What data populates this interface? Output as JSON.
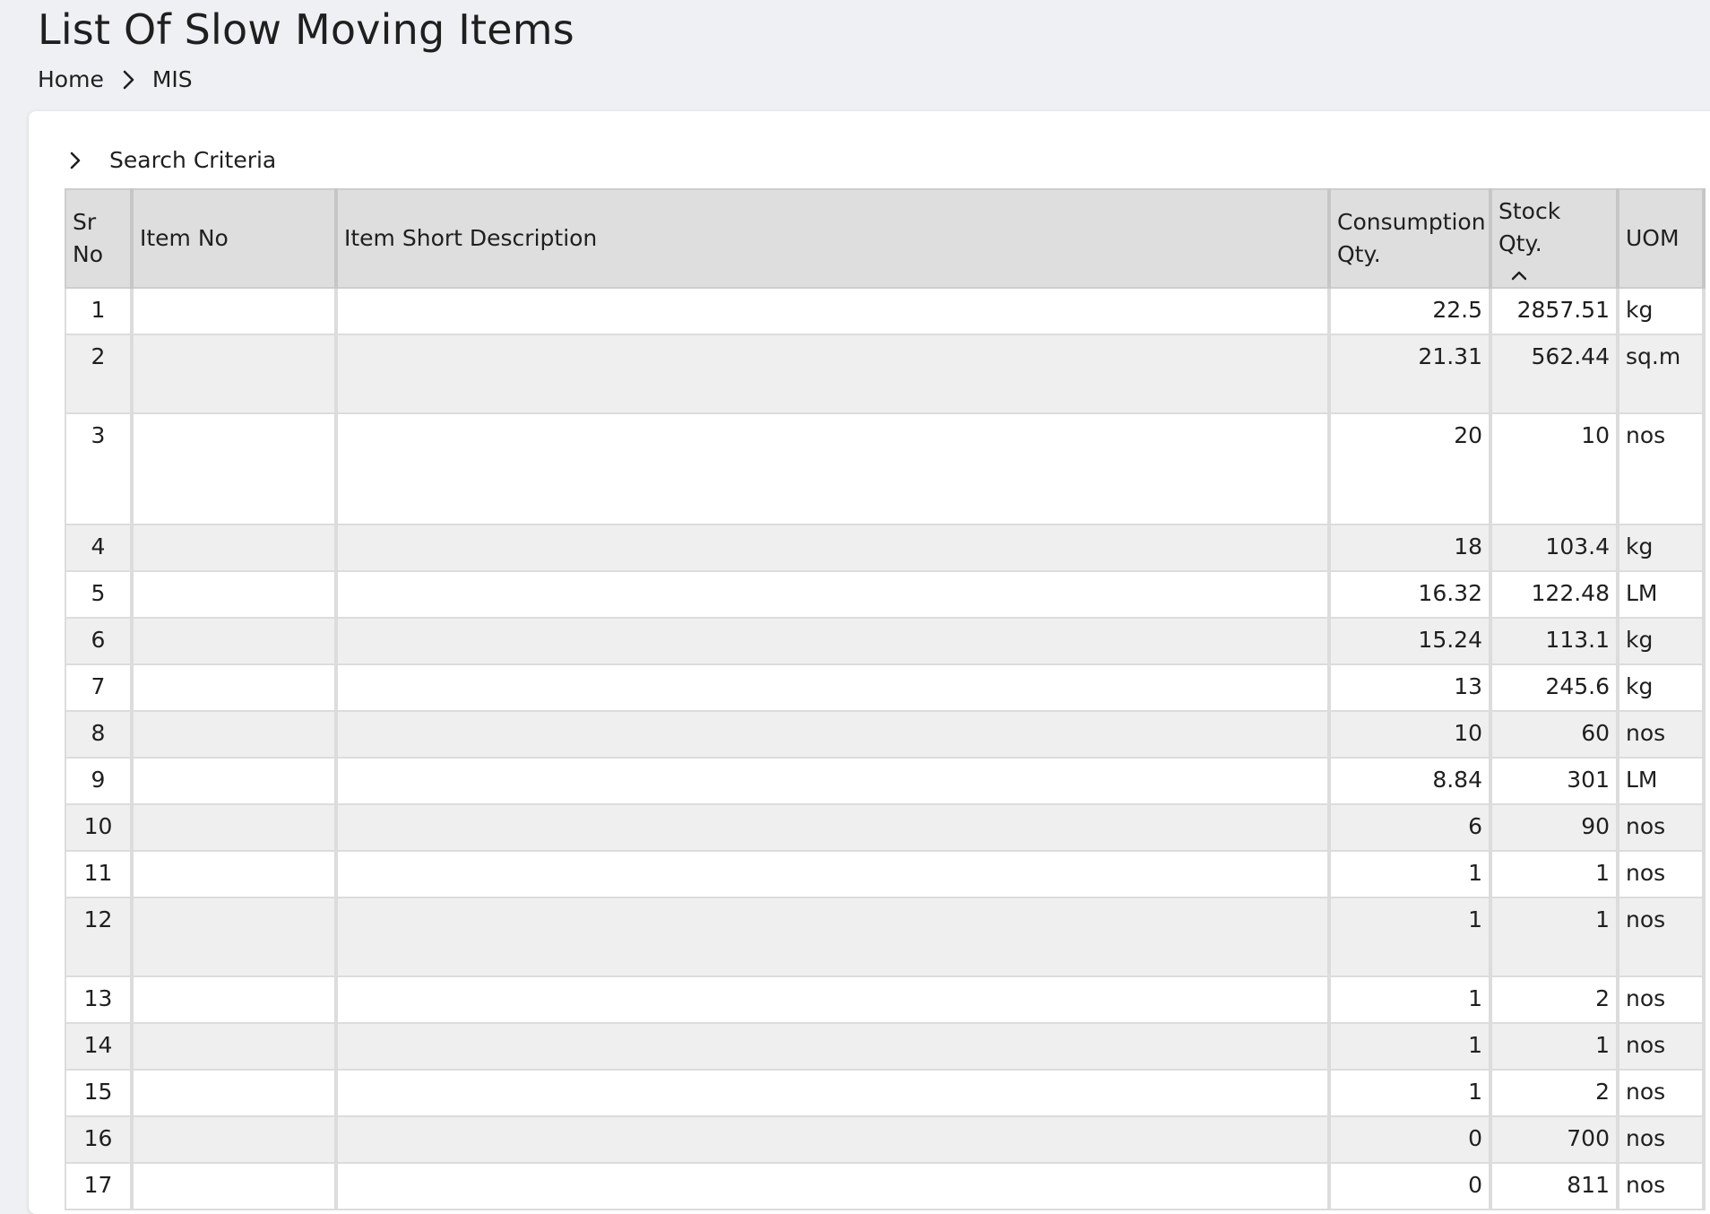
{
  "page": {
    "title": "List Of Slow Moving Items",
    "breadcrumb": [
      "Home",
      "MIS"
    ]
  },
  "search": {
    "label": "Search Criteria"
  },
  "table": {
    "headers": {
      "sr_no_line1": "Sr",
      "sr_no_line2": "No",
      "item_no": "Item No",
      "description": "Item Short Description",
      "consumption_line1": "Consumption",
      "consumption_line2": "Qty.",
      "stock_qty": "Stock Qty.",
      "uom": "UOM"
    },
    "sorted_column": "stock_qty",
    "sort_direction": "ascending",
    "rows": [
      {
        "sr": "1",
        "item_no": "",
        "desc": "",
        "consumption": "22.5",
        "stock": "2857.51",
        "uom": "kg"
      },
      {
        "sr": "2",
        "item_no": "",
        "desc": "",
        "consumption": "21.31",
        "stock": "562.44",
        "uom": "sq.m"
      },
      {
        "sr": "3",
        "item_no": "",
        "desc": "",
        "consumption": "20",
        "stock": "10",
        "uom": "nos"
      },
      {
        "sr": "4",
        "item_no": "",
        "desc": "",
        "consumption": "18",
        "stock": "103.4",
        "uom": "kg"
      },
      {
        "sr": "5",
        "item_no": "",
        "desc": "",
        "consumption": "16.32",
        "stock": "122.48",
        "uom": "LM"
      },
      {
        "sr": "6",
        "item_no": "",
        "desc": "",
        "consumption": "15.24",
        "stock": "113.1",
        "uom": "kg"
      },
      {
        "sr": "7",
        "item_no": "",
        "desc": "",
        "consumption": "13",
        "stock": "245.6",
        "uom": "kg"
      },
      {
        "sr": "8",
        "item_no": "",
        "desc": "",
        "consumption": "10",
        "stock": "60",
        "uom": "nos"
      },
      {
        "sr": "9",
        "item_no": "",
        "desc": "",
        "consumption": "8.84",
        "stock": "301",
        "uom": "LM"
      },
      {
        "sr": "10",
        "item_no": "",
        "desc": "",
        "consumption": "6",
        "stock": "90",
        "uom": "nos"
      },
      {
        "sr": "11",
        "item_no": "",
        "desc": "",
        "consumption": "1",
        "stock": "1",
        "uom": "nos"
      },
      {
        "sr": "12",
        "item_no": "",
        "desc": "",
        "consumption": "1",
        "stock": "1",
        "uom": "nos"
      },
      {
        "sr": "13",
        "item_no": "",
        "desc": "",
        "consumption": "1",
        "stock": "2",
        "uom": "nos"
      },
      {
        "sr": "14",
        "item_no": "",
        "desc": "",
        "consumption": "1",
        "stock": "1",
        "uom": "nos"
      },
      {
        "sr": "15",
        "item_no": "",
        "desc": "",
        "consumption": "1",
        "stock": "2",
        "uom": "nos"
      },
      {
        "sr": "16",
        "item_no": "",
        "desc": "",
        "consumption": "0",
        "stock": "700",
        "uom": "nos"
      },
      {
        "sr": "17",
        "item_no": "",
        "desc": "",
        "consumption": "0",
        "stock": "811",
        "uom": "nos"
      }
    ]
  }
}
